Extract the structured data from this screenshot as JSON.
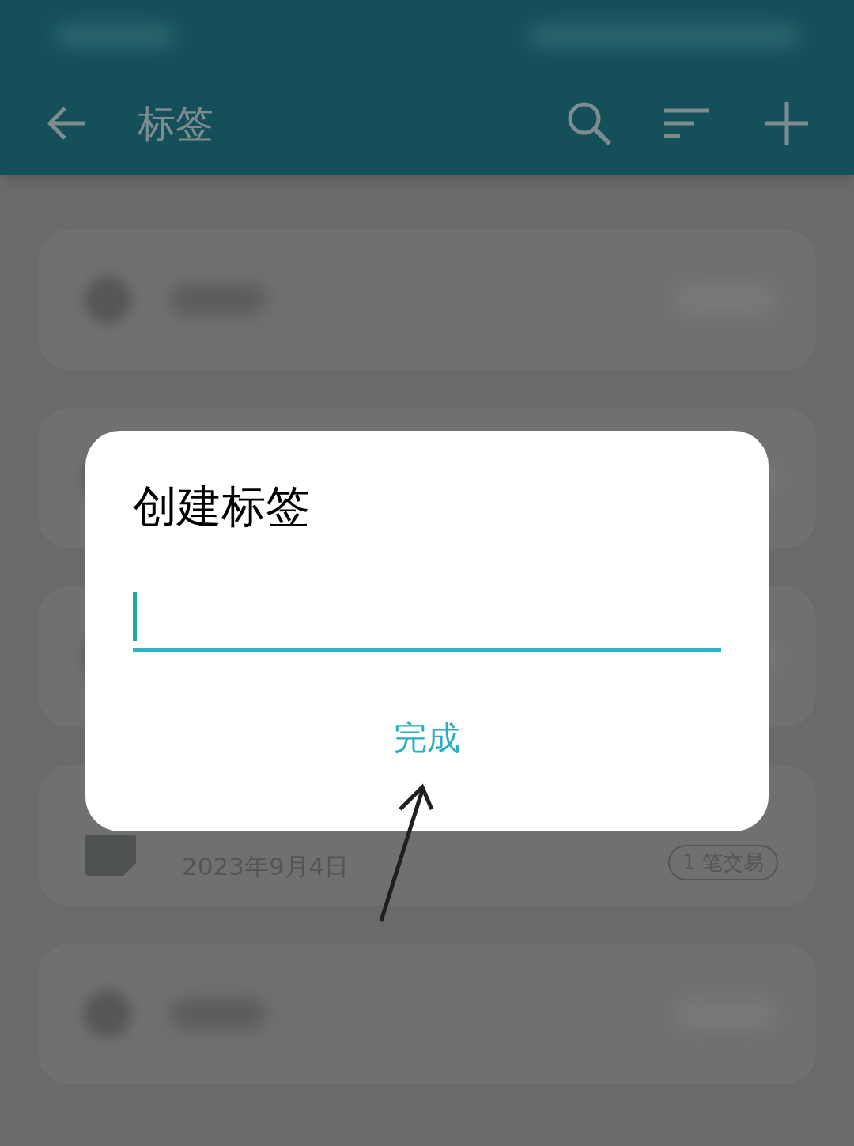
{
  "toolbar": {
    "title": "标签"
  },
  "cards": [
    {
      "kind": "blurred"
    },
    {
      "kind": "blurred"
    },
    {
      "kind": "blurred"
    },
    {
      "kind": "entry",
      "date": "2023年9月4日",
      "count": "1 笔交易"
    },
    {
      "kind": "blurred"
    }
  ],
  "dialog": {
    "title": "创建标签",
    "button": "完成"
  }
}
